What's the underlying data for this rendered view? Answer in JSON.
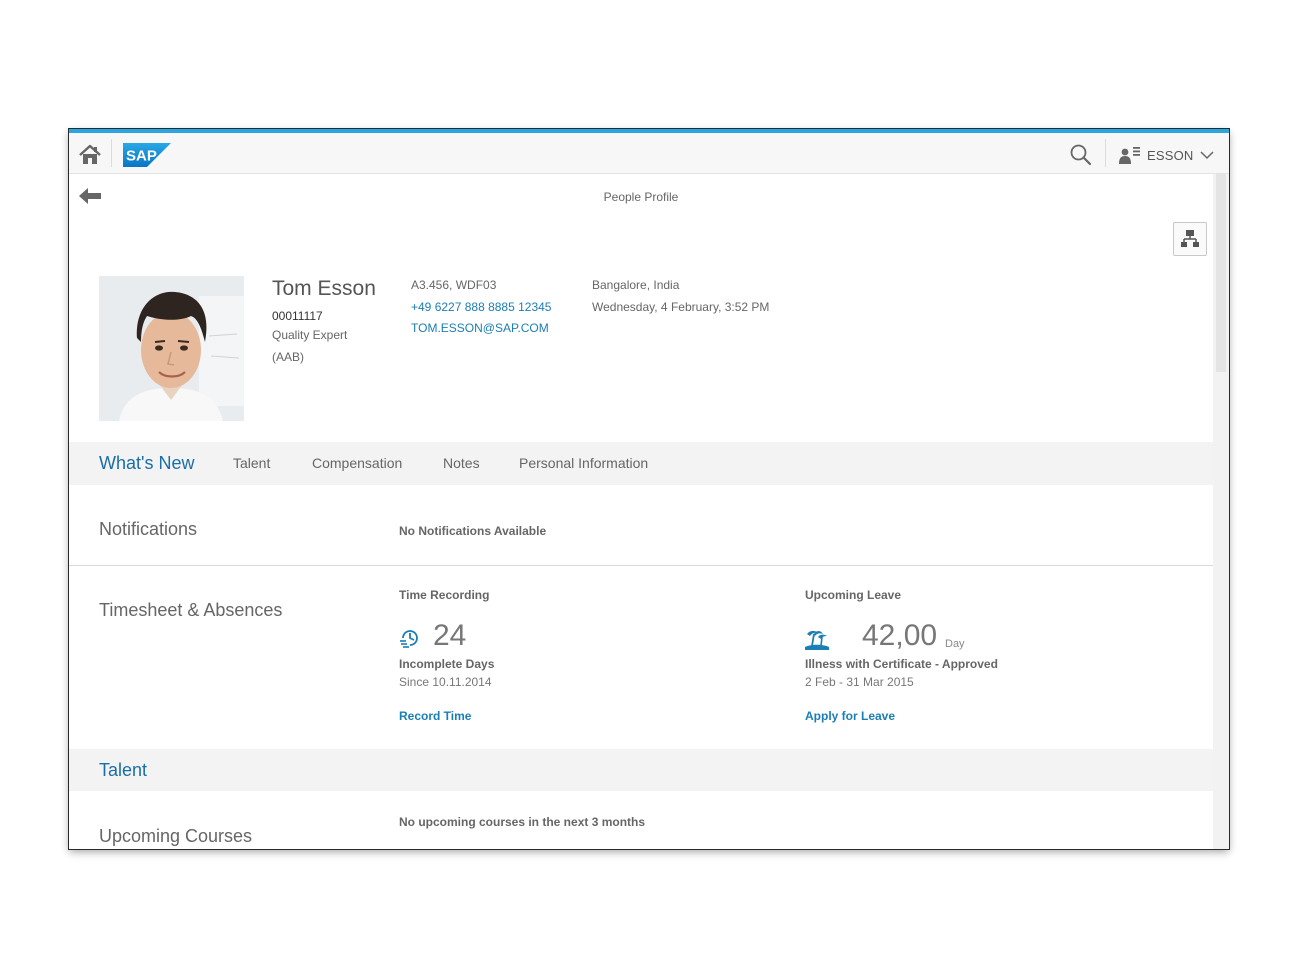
{
  "shell": {
    "logo_text": "SAP",
    "user_name": "ESSON",
    "accent_color": "#2aa6e0"
  },
  "header": {
    "title": "People Profile"
  },
  "profile": {
    "name": "Tom Esson",
    "employee_id": "00011117",
    "role": "Quality Expert",
    "org": "(AAB)",
    "office": "A3.456, WDF03",
    "phone": "+49 6227 888 8885 12345",
    "email": "TOM.ESSON@SAP.COM",
    "location": "Bangalore, India",
    "local_time": "Wednesday, 4 February, 3:52 PM"
  },
  "tabs": [
    {
      "label": "What's New",
      "active": true
    },
    {
      "label": "Talent"
    },
    {
      "label": "Compensation"
    },
    {
      "label": "Notes"
    },
    {
      "label": "Personal Information"
    }
  ],
  "notifications": {
    "label": "Notifications",
    "message": "No Notifications Available"
  },
  "timesheet": {
    "label": "Timesheet & Absences",
    "time_recording": {
      "title": "Time Recording",
      "value": "24",
      "caption": "Incomplete Days",
      "since": "Since 10.11.2014",
      "action": "Record Time"
    },
    "upcoming_leave": {
      "title": "Upcoming Leave",
      "value": "42,00",
      "unit": "Day",
      "caption": "Illness with Certificate - Approved",
      "range": "2 Feb - 31 Mar 2015",
      "action": "Apply for Leave"
    }
  },
  "talent": {
    "title": "Talent",
    "upcoming_courses": {
      "label": "Upcoming Courses",
      "message": "No upcoming courses in the next 3 months"
    }
  },
  "icons": {
    "home": "home-icon",
    "search": "search-icon",
    "user": "user-icon",
    "back": "back-arrow-icon",
    "org_chart": "org-chart-icon",
    "time": "time-history-icon",
    "leave": "beach-icon"
  }
}
